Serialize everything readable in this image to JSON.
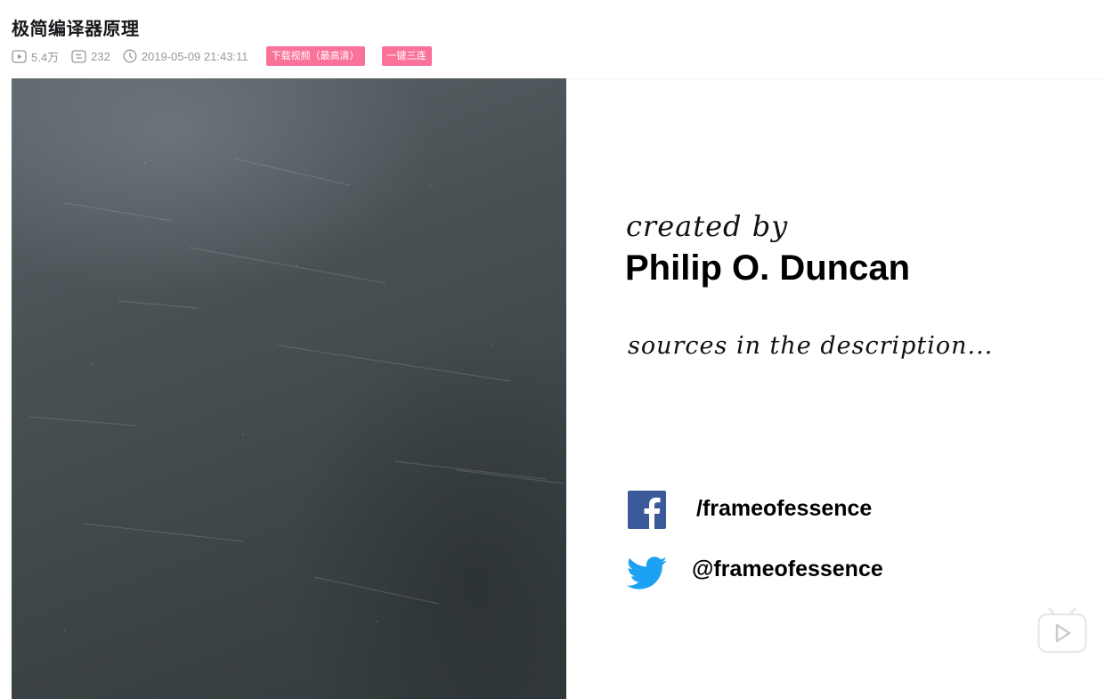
{
  "video": {
    "title": "极简编译器原理",
    "views": "5.4万",
    "danmaku": "232",
    "date": "2019-05-09 21:43:11",
    "download_label": "下载视频（最高清）",
    "triple_label": "一键三连"
  },
  "icons": {
    "views": "play-count-icon",
    "danmaku": "danmaku-icon",
    "date": "clock-icon",
    "facebook": "facebook-icon",
    "twitter": "twitter-icon",
    "tv": "bilibili-tv-icon"
  },
  "slide": {
    "created_by": "created by",
    "author": "Philip O. Duncan",
    "sources": "sources in the description...",
    "facebook_handle": "/frameofessence",
    "twitter_handle": "@frameofessence"
  },
  "colors": {
    "accent_pink": "#fb7299",
    "facebook_blue": "#3b5998",
    "twitter_blue": "#1da1f2",
    "meta_grey": "#9499a0"
  }
}
